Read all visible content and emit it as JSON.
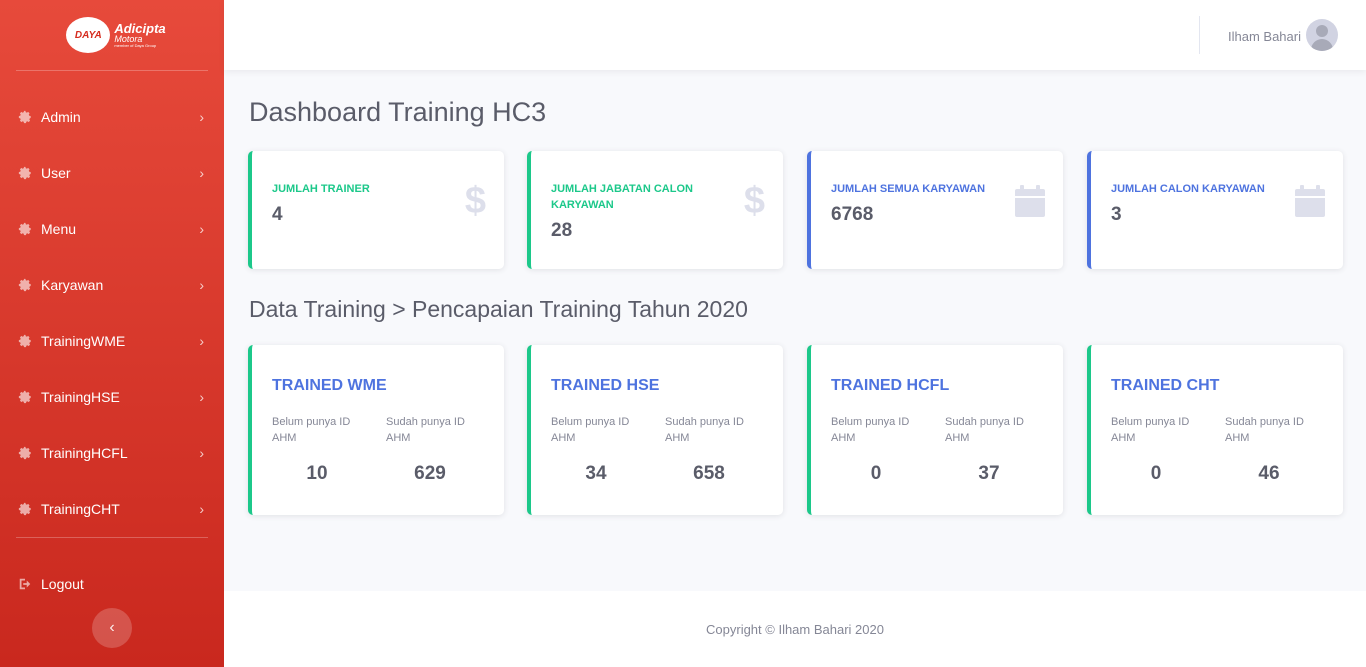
{
  "brand": {
    "logo_mark": "DAYA",
    "logo_name": "Adicipta",
    "logo_sub": "Motora",
    "logo_tagline": "member of Daya Group"
  },
  "sidebar": {
    "items": [
      {
        "label": "Admin",
        "icon": "gear-icon"
      },
      {
        "label": "User",
        "icon": "gear-icon"
      },
      {
        "label": "Menu",
        "icon": "gear-icon"
      },
      {
        "label": "Karyawan",
        "icon": "gear-icon"
      },
      {
        "label": "TrainingWME",
        "icon": "gear-icon"
      },
      {
        "label": "TrainingHSE",
        "icon": "gear-icon"
      },
      {
        "label": "TrainingHCFL",
        "icon": "gear-icon"
      },
      {
        "label": "TrainingCHT",
        "icon": "gear-icon"
      }
    ],
    "logout_label": "Logout",
    "toggle_icon": "chevron-left-icon"
  },
  "topbar": {
    "user_name": "Ilham Bahari"
  },
  "main": {
    "title": "Dashboard Training HC3",
    "stats": [
      {
        "label": "JUMLAH TRAINER",
        "value": "4",
        "icon": "dollar-icon",
        "accent": "#1cc88a"
      },
      {
        "label": "JUMLAH JABATAN CALON KARYAWAN",
        "value": "28",
        "icon": "dollar-icon",
        "accent": "#1cc88a"
      },
      {
        "label": "JUMLAH SEMUA KARYAWAN",
        "value": "6768",
        "icon": "calendar-icon",
        "accent": "#4e73df"
      },
      {
        "label": "JUMLAH CALON KARYAWAN",
        "value": "3",
        "icon": "calendar-icon",
        "accent": "#4e73df"
      }
    ],
    "section_title": "Data Training > Pencapaian Training Tahun 2020",
    "trainings": [
      {
        "title": "TRAINED WME",
        "belum_label": "Belum punya ID AHM",
        "sudah_label": "Sudah punya ID AHM",
        "belum": "10",
        "sudah": "629"
      },
      {
        "title": "TRAINED HSE",
        "belum_label": "Belum punya ID AHM",
        "sudah_label": "Sudah punya ID AHM",
        "belum": "34",
        "sudah": "658"
      },
      {
        "title": "TRAINED HCFL",
        "belum_label": "Belum punya ID AHM",
        "sudah_label": "Sudah punya ID AHM",
        "belum": "0",
        "sudah": "37"
      },
      {
        "title": "TRAINED CHT",
        "belum_label": "Belum punya ID AHM",
        "sudah_label": "Sudah punya ID AHM",
        "belum": "0",
        "sudah": "46"
      }
    ]
  },
  "footer": {
    "copyright": "Copyright © Ilham Bahari 2020"
  },
  "colors": {
    "sidebar_top": "#e74a3b",
    "sidebar_bottom": "#c9281e",
    "success": "#1cc88a",
    "primary": "#4e73df",
    "text": "#5a5c69",
    "muted": "#858796"
  }
}
